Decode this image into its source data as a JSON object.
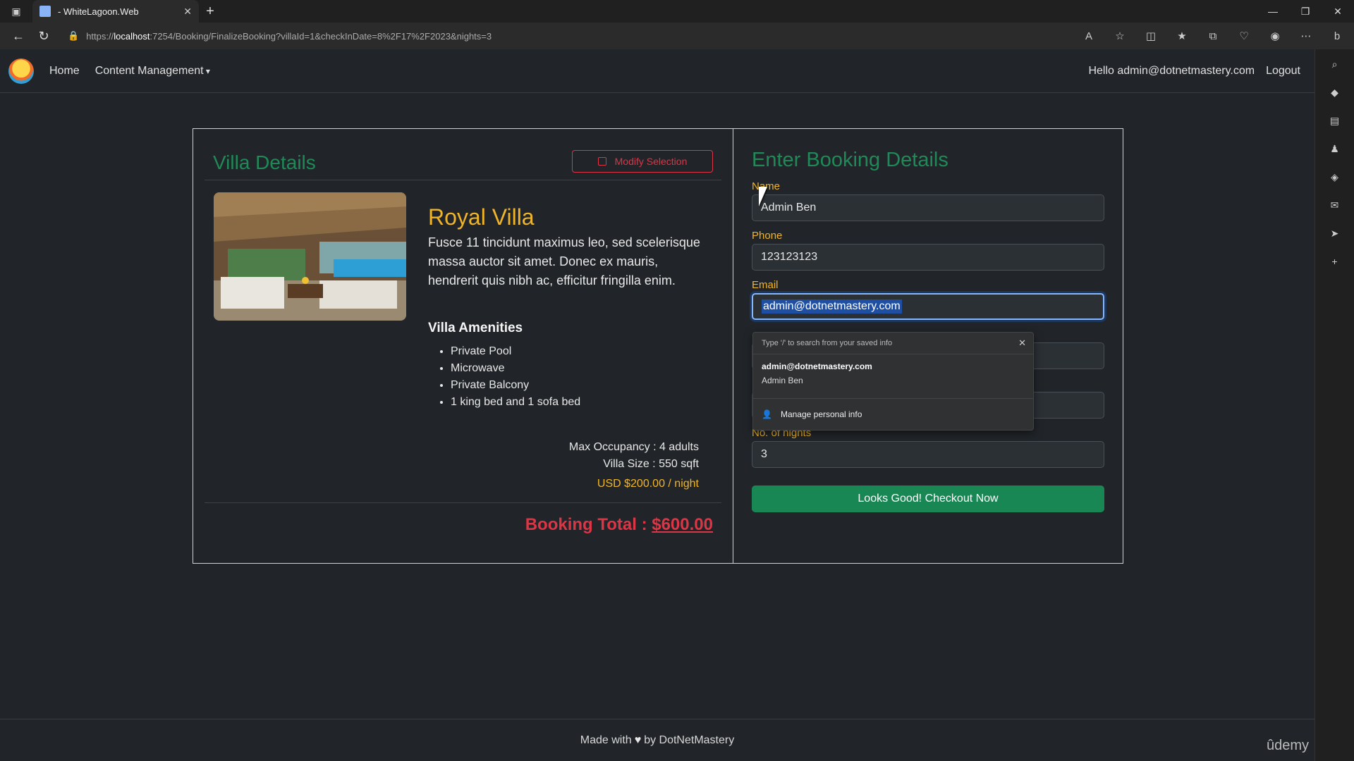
{
  "browser": {
    "tab_title": "- WhiteLagoon.Web",
    "url_prefix": "https://",
    "url_host": "localhost",
    "url_rest": ":7254/Booking/FinalizeBooking?villaId=1&checkInDate=8%2F17%2F2023&nights=3"
  },
  "navbar": {
    "home": "Home",
    "content_management": "Content Management",
    "hello": "Hello admin@dotnetmastery.com",
    "logout": "Logout"
  },
  "villa": {
    "section_title": "Villa Details",
    "modify_label": "Modify Selection",
    "name": "Royal Villa",
    "description": "Fusce 11 tincidunt maximus leo, sed scelerisque massa auctor sit amet. Donec ex mauris, hendrerit quis nibh ac, efficitur fringilla enim.",
    "amenities_title": "Villa Amenities",
    "amenities": [
      "Private Pool",
      "Microwave",
      "Private Balcony",
      "1 king bed and 1 sofa bed"
    ],
    "max_occupancy": "Max Occupancy : 4 adults",
    "villa_size": "Villa Size : 550 sqft",
    "price": "USD $200.00 / night",
    "booking_total_label": "Booking Total : ",
    "booking_total_amount": "$600.00"
  },
  "booking": {
    "title": "Enter Booking Details",
    "name_label": "Name",
    "name_value": "Admin Ben",
    "phone_label": "Phone",
    "phone_value": "123123123",
    "email_label": "Email",
    "email_value": "admin@dotnetmastery.com",
    "nights_label": "No. of nights",
    "nights_value": "3",
    "checkout_label": "Looks Good! Checkout Now"
  },
  "autofill": {
    "hint": "Type '/' to search from your saved info",
    "email": "admin@dotnetmastery.com",
    "name": "Admin Ben",
    "manage": "Manage personal info"
  },
  "footer": {
    "made_with": "Made with",
    "by": "by DotNetMastery"
  },
  "watermark": "ûdemy"
}
